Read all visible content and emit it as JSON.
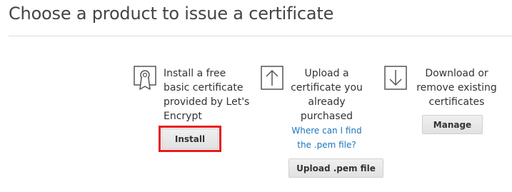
{
  "header": {
    "title": "Choose a product to issue a certificate"
  },
  "options": [
    {
      "icon": "certificate-badge-icon",
      "lines": [
        "Install a free",
        "basic certificate",
        "provided by Let's",
        "Encrypt"
      ],
      "button_label": "Install"
    },
    {
      "icon": "upload-arrow-icon",
      "lines": [
        "Upload a",
        "certificate you",
        "already",
        "purchased"
      ],
      "help_link_lines": [
        "Where can I find",
        "the .pem file?"
      ],
      "button_label": "Upload .pem file"
    },
    {
      "icon": "download-arrow-icon",
      "lines": [
        "Download or",
        "remove existing",
        "certificates"
      ],
      "button_label": "Manage"
    }
  ],
  "colors": {
    "link": "#1b75bb",
    "highlight": "#e8191c",
    "divider": "#dcdcdc"
  }
}
